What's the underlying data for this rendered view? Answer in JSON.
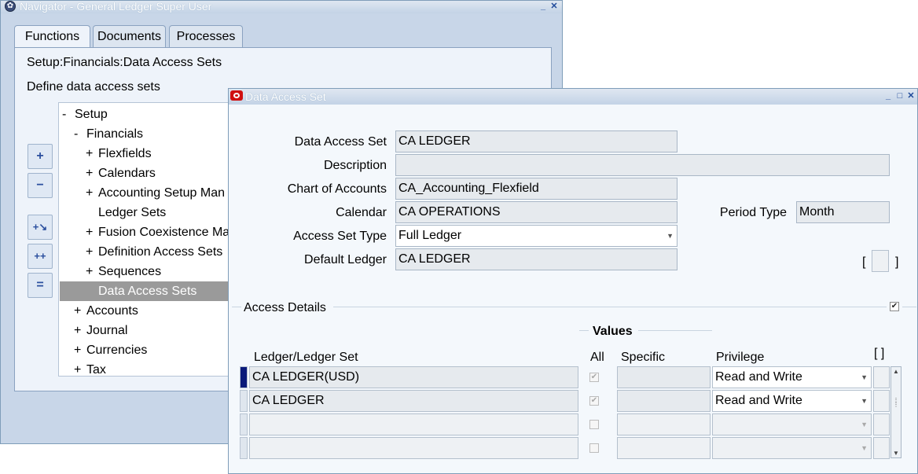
{
  "navigator": {
    "title": "Navigator - General Ledger Super User",
    "tabs": [
      "Functions",
      "Documents",
      "Processes"
    ],
    "path": "Setup:Financials:Data Access Sets",
    "description": "Define data access sets",
    "tree": [
      {
        "pm": "-",
        "label": "Setup"
      },
      {
        "pm": "-",
        "label": "Financials"
      },
      {
        "pm": "+",
        "label": "Flexfields"
      },
      {
        "pm": "+",
        "label": "Calendars"
      },
      {
        "pm": "+",
        "label": "Accounting Setup Man"
      },
      {
        "pm": "",
        "label": "Ledger Sets"
      },
      {
        "pm": "+",
        "label": "Fusion Coexistence Ma"
      },
      {
        "pm": "+",
        "label": "Definition Access Sets"
      },
      {
        "pm": "+",
        "label": "Sequences"
      },
      {
        "pm": "",
        "label": "Data Access Sets"
      },
      {
        "pm": "+",
        "label": "Accounts"
      },
      {
        "pm": "+",
        "label": "Journal"
      },
      {
        "pm": "+",
        "label": "Currencies"
      },
      {
        "pm": "+",
        "label": "Tax"
      }
    ],
    "buttons": {
      "expand": "+",
      "collapse": "−",
      "expand_branch": "+↘",
      "expand_all": "++",
      "collapse_all": "="
    }
  },
  "das": {
    "title": "Data Access Set",
    "labels": {
      "name": "Data Access Set",
      "description": "Description",
      "coa": "Chart of Accounts",
      "calendar": "Calendar",
      "period_type": "Period Type",
      "access_set_type": "Access Set Type",
      "default_ledger": "Default Ledger"
    },
    "values": {
      "name": "CA LEDGER",
      "description": "",
      "coa": "CA_Accounting_Flexfield",
      "calendar": "CA OPERATIONS",
      "period_type": "Month",
      "access_set_type": "Full Ledger",
      "default_ledger": "CA LEDGER"
    },
    "bracket_open": "[",
    "bracket_close": "]",
    "access_details": "Access Details",
    "values_header": "Values",
    "columns": {
      "ledger": "Ledger/Ledger Set",
      "all": "All",
      "specific": "Specific",
      "privilege": "Privilege",
      "dff": "[ ]"
    },
    "rows": [
      {
        "ledger": "CA LEDGER(USD)",
        "all": true,
        "specific": "",
        "privilege": "Read and Write"
      },
      {
        "ledger": "CA LEDGER",
        "all": true,
        "specific": "",
        "privilege": "Read and Write"
      },
      {
        "ledger": "",
        "all": false,
        "specific": "",
        "privilege": ""
      },
      {
        "ledger": "",
        "all": false,
        "specific": "",
        "privilege": ""
      }
    ]
  },
  "colors": {
    "selected_row": "#9a9a9a",
    "current_record": "#0a1a7a",
    "oracle_red": "#d01010"
  }
}
